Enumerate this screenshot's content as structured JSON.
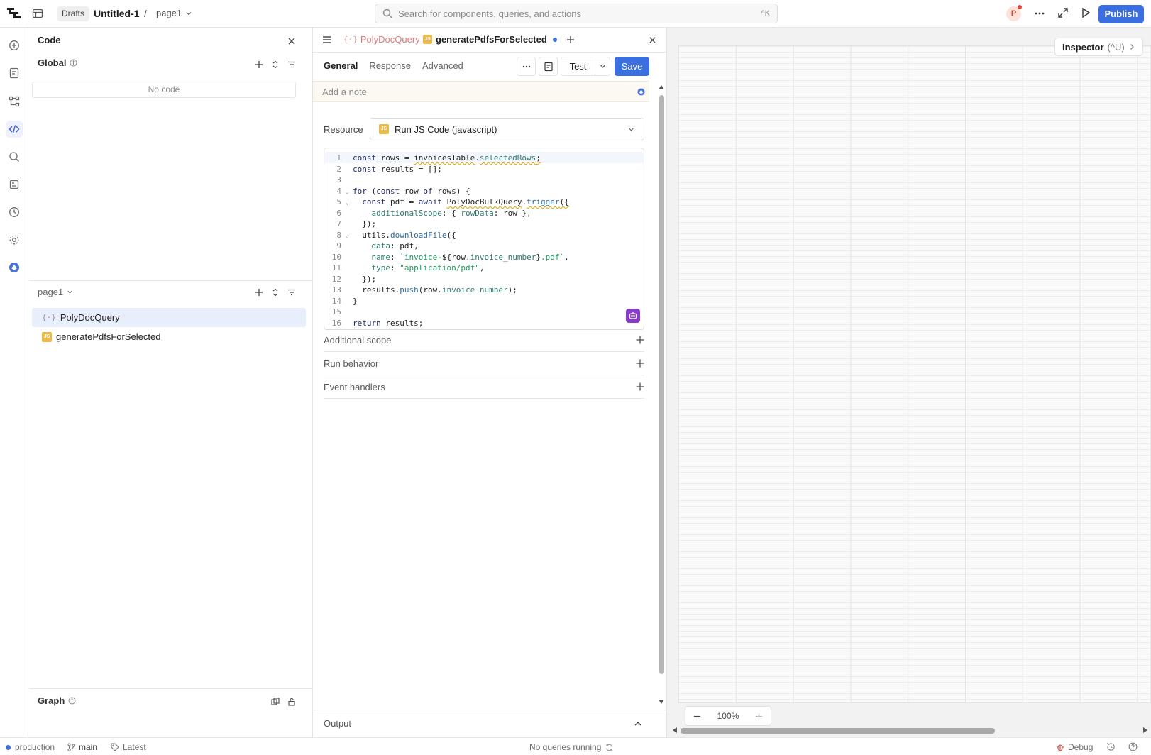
{
  "topbar": {
    "drafts_label": "Drafts",
    "app_name": "Untitled-1",
    "separator": "/",
    "page_name": "page1",
    "search_placeholder": "Search for components, queries, and actions",
    "search_shortcut": "^K",
    "avatar_initial": "P",
    "publish_label": "Publish"
  },
  "code_panel": {
    "title": "Code",
    "global_label": "Global",
    "no_code_label": "No code",
    "page_label": "page1",
    "items": [
      {
        "name": "PolyDocQuery",
        "icon": "query-braces-icon",
        "selected": true
      },
      {
        "name": "generatePdfsForSelected",
        "icon": "js-icon",
        "selected": false
      }
    ],
    "graph_label": "Graph"
  },
  "query_panel": {
    "tabs": [
      {
        "label": "PolyDocQuery",
        "icon": "query-braces-icon",
        "active": false
      },
      {
        "label": "generatePdfsForSelected",
        "icon": "js-icon",
        "active": true,
        "unsaved": true
      }
    ],
    "subtabs": [
      "General",
      "Response",
      "Advanced"
    ],
    "active_subtab": "General",
    "test_label": "Test",
    "save_label": "Save",
    "note_placeholder": "Add a note",
    "resource_label": "Resource",
    "resource_value": "Run JS Code (javascript)",
    "js_badge": "JS",
    "sections": [
      "Additional scope",
      "Run behavior",
      "Event handlers"
    ],
    "output_label": "Output"
  },
  "code_lines": [
    "const rows = invoicesTable.selectedRows;",
    "const results = [];",
    "",
    "for (const row of rows) {",
    "  const pdf = await PolyDocBulkQuery.trigger({",
    "    additionalScope: { rowData: row },",
    "  });",
    "  utils.downloadFile({",
    "    data: pdf,",
    "    name: `invoice-${row.invoice_number}.pdf`,",
    "    type: \"application/pdf\",",
    "  });",
    "  results.push(row.invoice_number);",
    "}",
    "",
    "return results;"
  ],
  "canvas": {
    "inspector_label": "Inspector",
    "inspector_shortcut": "(^U)",
    "zoom_label": "100%"
  },
  "statusbar": {
    "env_label": "production",
    "branch_label": "main",
    "version_label": "Latest",
    "queries_status": "No queries running",
    "debug_label": "Debug"
  },
  "colors": {
    "accent": "#3b6fe0",
    "selected_row": "#e8eefb",
    "js_badge": "#e9b949",
    "avatar_bg": "#fde3dc",
    "avatar_text": "#d4452b"
  }
}
